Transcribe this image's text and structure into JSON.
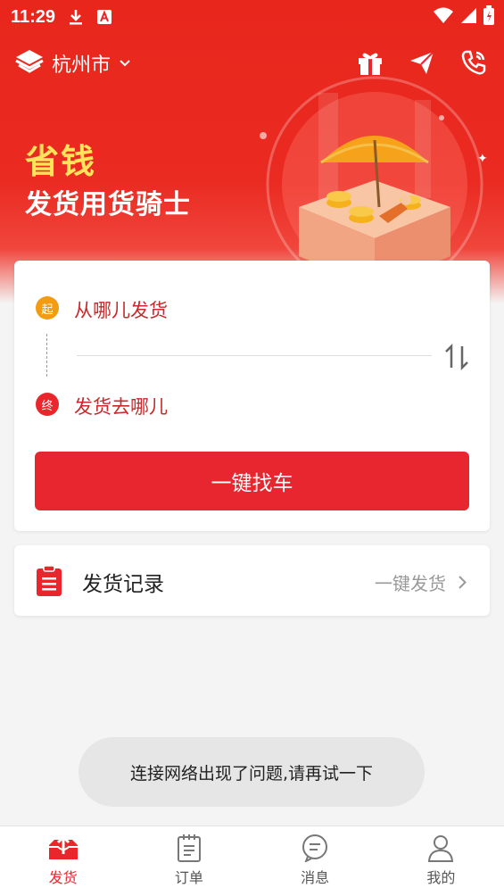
{
  "status_bar": {
    "time": "11:29"
  },
  "header": {
    "city": "杭州市"
  },
  "banner": {
    "slogan_primary": "省钱",
    "slogan_secondary": "发货用货骑士"
  },
  "route_card": {
    "start_badge": "起",
    "end_badge": "终",
    "from_placeholder": "从哪儿发货",
    "to_placeholder": "发货去哪儿",
    "find_button": "一键找车"
  },
  "record": {
    "title": "发货记录",
    "action": "一键发货"
  },
  "toast": {
    "message": "连接网络出现了问题,请再试一下"
  },
  "tabbar": {
    "tabs": [
      {
        "label": "发货",
        "icon": "upload-box-icon",
        "active": true
      },
      {
        "label": "订单",
        "icon": "clipboard-icon",
        "active": false
      },
      {
        "label": "消息",
        "icon": "chat-bubble-icon",
        "active": false
      },
      {
        "label": "我的",
        "icon": "person-icon",
        "active": false
      }
    ]
  },
  "colors": {
    "brand_red": "#e8262c",
    "slogan_yellow": "#ffe35a",
    "start_orange": "#f39c12"
  }
}
